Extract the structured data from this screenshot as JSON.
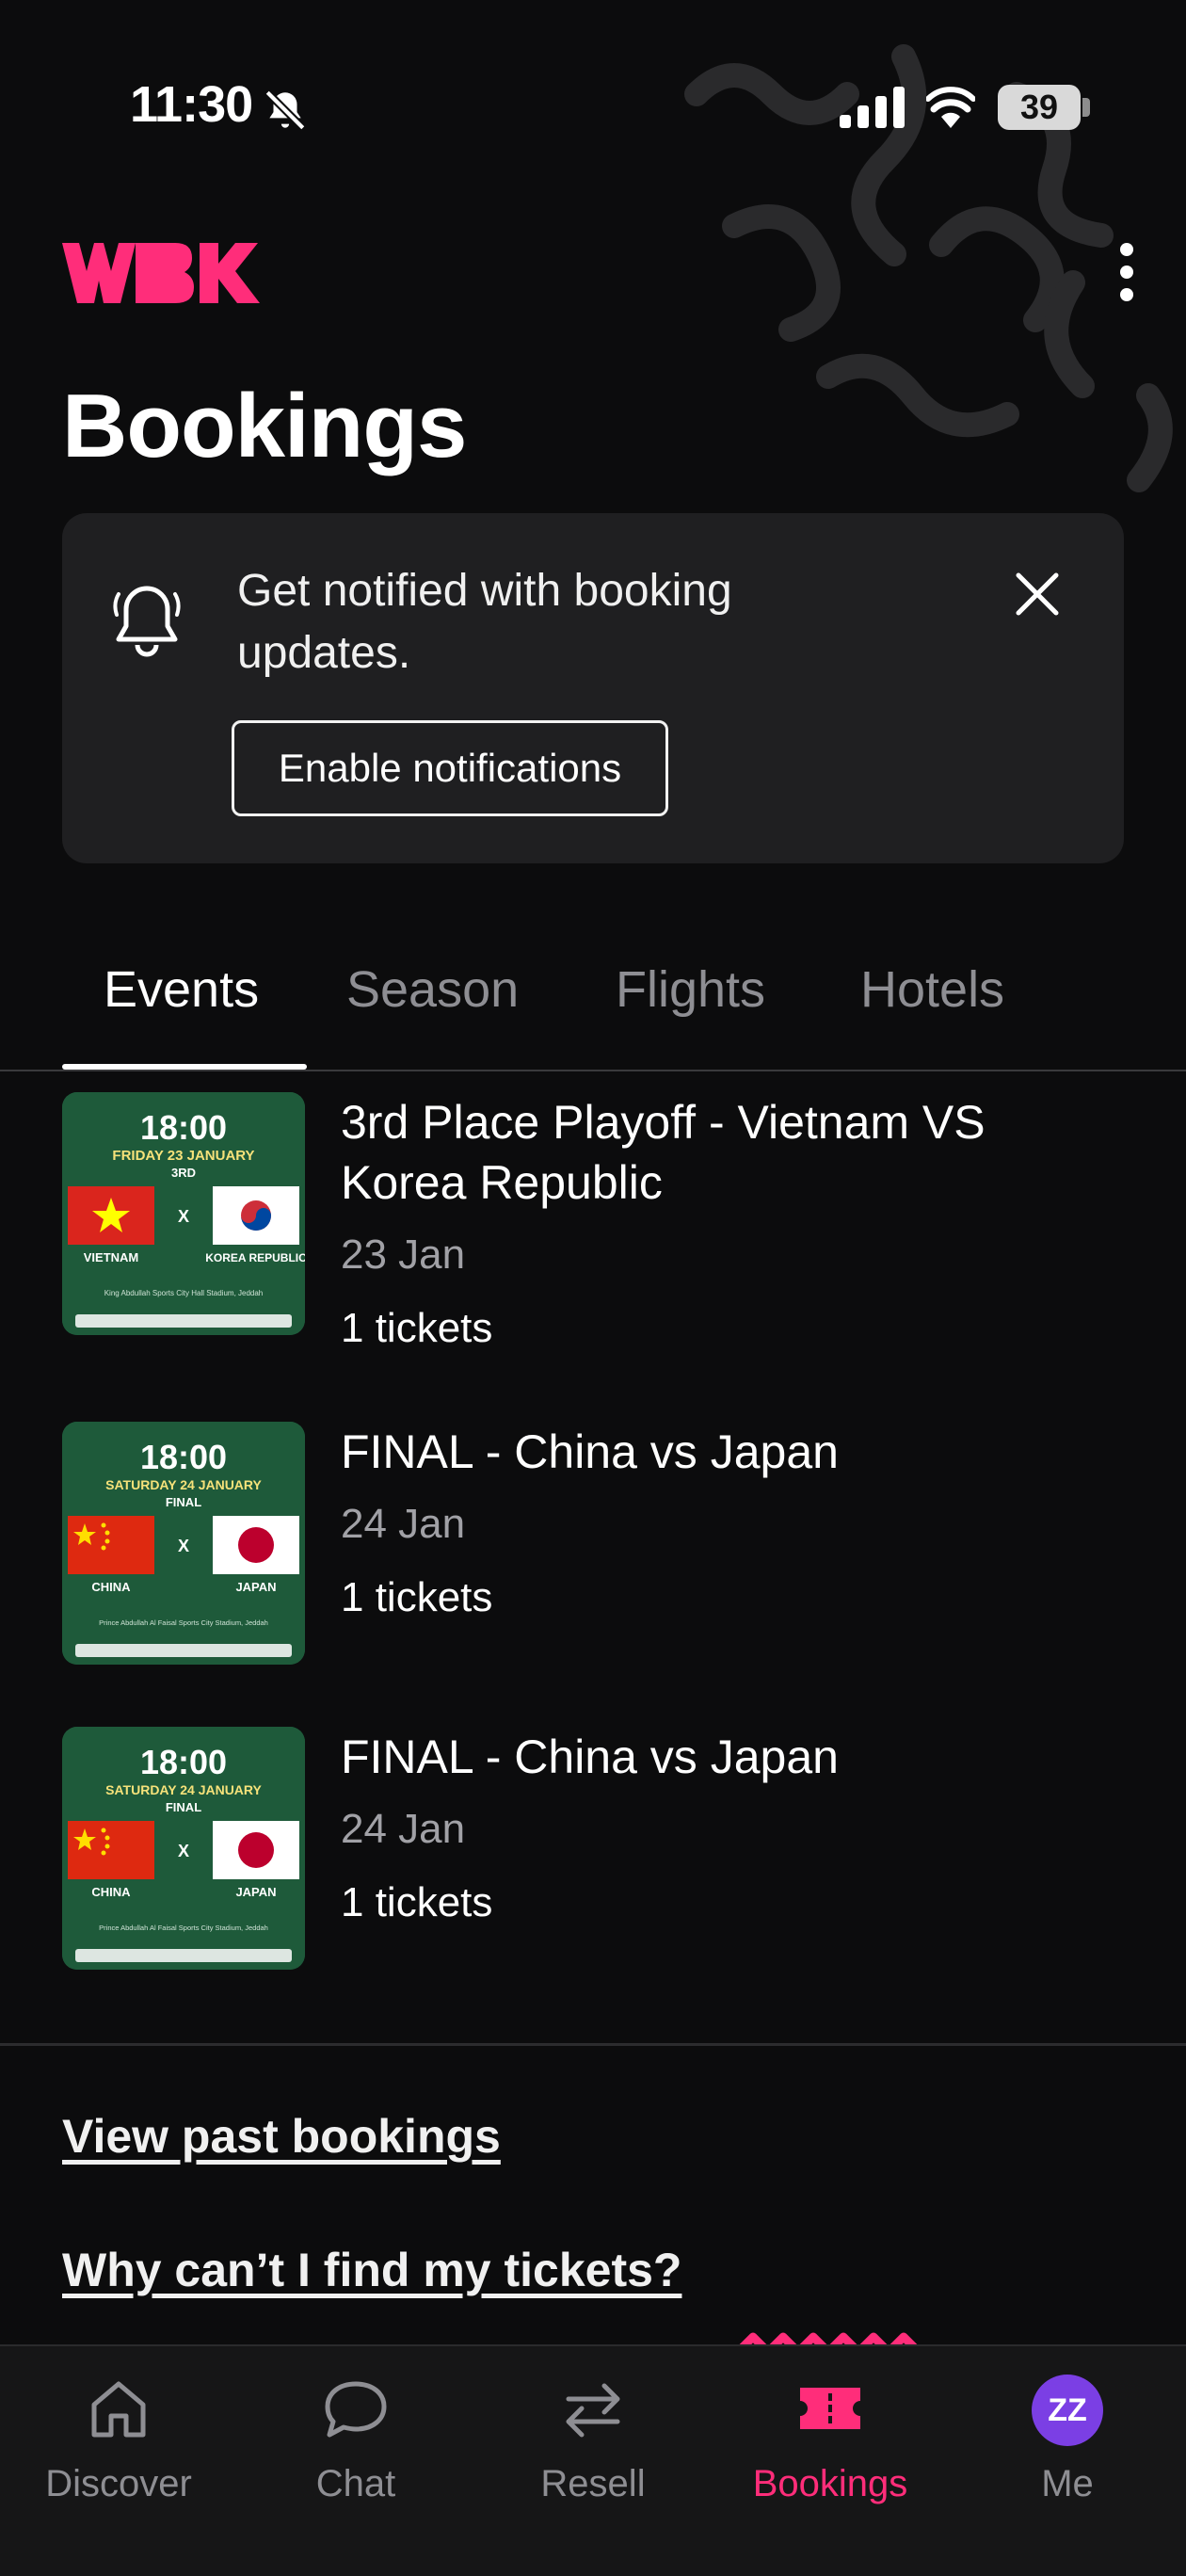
{
  "status_bar": {
    "time": "11:30",
    "battery": "39",
    "icons": [
      "bell-off-icon",
      "signal-icon",
      "wifi-icon",
      "battery-icon"
    ]
  },
  "header": {
    "logo": "WBK",
    "title": "Bookings",
    "menu_icon": "kebab-menu-icon"
  },
  "notification_card": {
    "text": "Get notified with booking updates.",
    "button_label": "Enable notifications",
    "icon": "bell-icon",
    "close_icon": "close-icon"
  },
  "tabs": [
    {
      "label": "Events",
      "active": true
    },
    {
      "label": "Season",
      "active": false
    },
    {
      "label": "Flights",
      "active": false
    },
    {
      "label": "Hotels",
      "active": false
    }
  ],
  "bookings": [
    {
      "title": "3rd Place Playoff - Vietnam VS Korea Republic",
      "date": "23 Jan",
      "tickets": "1 tickets",
      "poster": {
        "time": "18:00",
        "day": "FRIDAY 23 JANUARY",
        "stage": "3RD",
        "vs": "X",
        "team_left": "VIETNAM",
        "team_right": "KOREA REPUBLIC",
        "venue": "King Abdullah Sports City Hall Stadium, Jeddah"
      }
    },
    {
      "title": "FINAL - China vs Japan",
      "date": "24 Jan",
      "tickets": "1 tickets",
      "poster": {
        "time": "18:00",
        "day": "SATURDAY 24 JANUARY",
        "stage": "FINAL",
        "vs": "X",
        "team_left": "CHINA",
        "team_right": "JAPAN",
        "venue": "Prince Abdullah Al Faisal Sports City Stadium, Jeddah"
      }
    },
    {
      "title": "FINAL - China vs Japan",
      "date": "24 Jan",
      "tickets": "1 tickets",
      "poster": {
        "time": "18:00",
        "day": "SATURDAY 24 JANUARY",
        "stage": "FINAL",
        "vs": "X",
        "team_left": "CHINA",
        "team_right": "JAPAN",
        "venue": "Prince Abdullah Al Faisal Sports City Stadium, Jeddah"
      }
    }
  ],
  "links": {
    "past_bookings": "View past bookings",
    "help": "Why can’t I find my tickets?"
  },
  "bottom_nav": [
    {
      "label": "Discover",
      "icon": "home-icon",
      "active": false
    },
    {
      "label": "Chat",
      "icon": "chat-bubble-icon",
      "active": false
    },
    {
      "label": "Resell",
      "icon": "swap-arrows-icon",
      "active": false
    },
    {
      "label": "Bookings",
      "icon": "ticket-icon",
      "active": true
    },
    {
      "label": "Me",
      "icon": "avatar",
      "active": false,
      "avatar_initials": "ZZ"
    }
  ],
  "colors": {
    "background": "#0c0c0d",
    "card": "#1f1f21",
    "accent": "#ff2d7a",
    "avatar": "#7b3fe4",
    "poster_green": "#1e5a3a"
  }
}
